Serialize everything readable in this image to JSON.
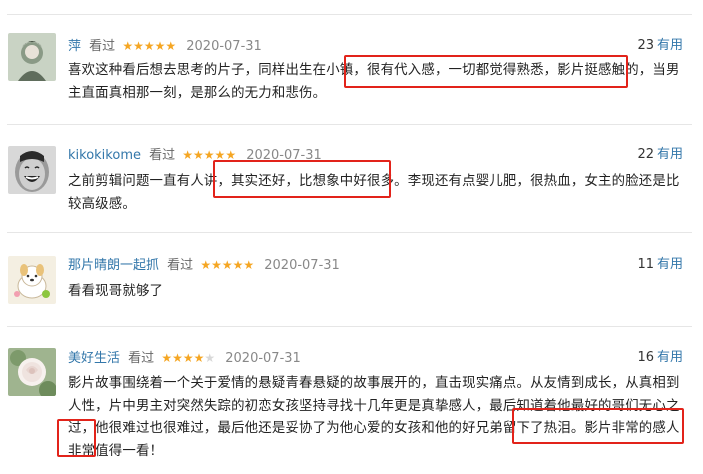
{
  "reviews": [
    {
      "user": "萍",
      "status": "看过",
      "stars": "★★★★★",
      "date": "2020-07-31",
      "votes": "23",
      "useful_label": "有用",
      "text": "喜欢这种看后想去思考的片子，同样出生在小镇，很有代入感，一切都觉得熟悉，影片挺感触的，当男主直面真相那一刻，是那么的无力和悲伤。",
      "avatar_icon": "woman-portrait-avatar"
    },
    {
      "user": "kikokikome",
      "status": "看过",
      "stars": "★★★★★",
      "date": "2020-07-31",
      "votes": "22",
      "useful_label": "有用",
      "text": "之前剪辑问题一直有人讲，其实还好，比想象中好很多。李现还有点婴儿肥，很热血，女主的脸还是比较高级感。",
      "avatar_icon": "laughing-face-avatar"
    },
    {
      "user": "那片晴朗一起抓",
      "status": "看过",
      "stars": "★★★★★",
      "date": "2020-07-31",
      "votes": "11",
      "useful_label": "有用",
      "text": "看看现哥就够了",
      "avatar_icon": "cartoon-dog-avatar"
    },
    {
      "user": "美好生活",
      "status": "看过",
      "stars": "★★★★",
      "stars_empty": "★",
      "date": "2020-07-31",
      "votes": "16",
      "useful_label": "有用",
      "text": "影片故事围绕着一个关于爱情的悬疑青春悬疑的故事展开的，直击现实痛点。从友情到成长，从真相到人性，片中男主对突然失踪的初恋女孩坚持寻找十几年更是真挚感人，最后知道着他最好的哥们无心之过，他很难过也很难过，最后他还是妥协了为他心爱的女孩和他的好兄弟留下了热泪。影片非常的感人非常值得一看！",
      "avatar_icon": "white-rose-avatar"
    }
  ],
  "colors": {
    "link": "#3377aa",
    "star": "#f5a623",
    "highlight": "#e2231a"
  }
}
